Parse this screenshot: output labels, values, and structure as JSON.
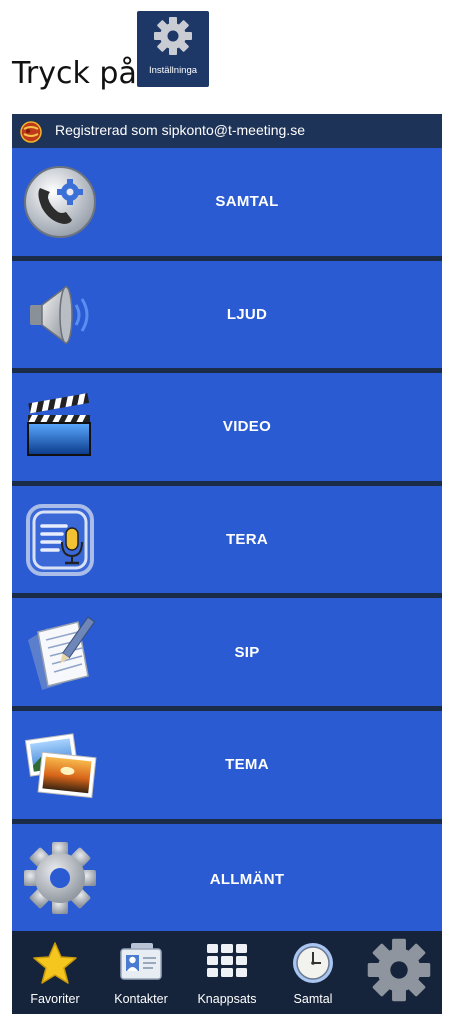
{
  "instruction": {
    "text": "Tryck på",
    "chip_label": "Inställninga"
  },
  "status_bar": {
    "text": "Registrerad som sipkonto@t-meeting.se"
  },
  "menu": [
    {
      "label": "SAMTAL",
      "icon": "phone-settings-icon"
    },
    {
      "label": "LJUD",
      "icon": "speaker-icon"
    },
    {
      "label": "VIDEO",
      "icon": "clapperboard-icon"
    },
    {
      "label": "TERA",
      "icon": "microphone-text-icon"
    },
    {
      "label": "SIP",
      "icon": "notepad-pen-icon"
    },
    {
      "label": "TEMA",
      "icon": "photos-icon"
    },
    {
      "label": "ALLMÄNT",
      "icon": "gear-icon"
    }
  ],
  "bottom_nav": [
    {
      "label": "Favoriter",
      "icon": "star-icon"
    },
    {
      "label": "Kontakter",
      "icon": "contact-card-icon"
    },
    {
      "label": "Knappsats",
      "icon": "keypad-icon"
    },
    {
      "label": "Samtal",
      "icon": "clock-icon"
    },
    {
      "label": "",
      "icon": "gear-icon"
    }
  ],
  "colors": {
    "menu_row": "#2a5bd3",
    "separator": "#1a2c47",
    "status_bar": "#1e3358",
    "bottom_nav": "#15243b"
  }
}
